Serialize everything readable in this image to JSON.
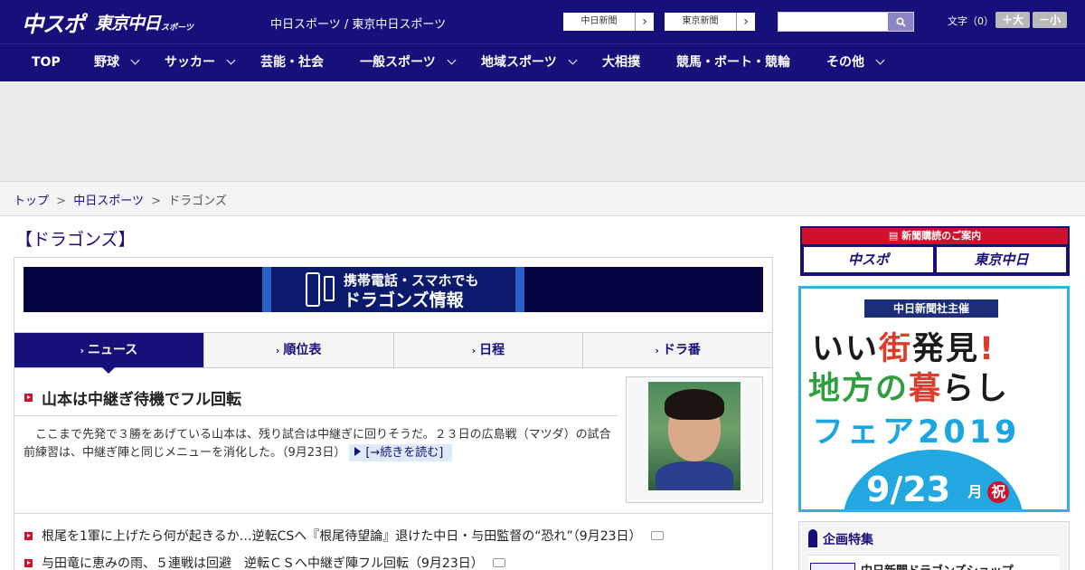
{
  "header": {
    "logo_main": "中スポ",
    "logo_sub": "東京中日",
    "logo_sub_small": "スポーツ",
    "site_name": "中日スポーツ / 東京中日スポーツ",
    "paper_links": [
      {
        "label": "中日新聞"
      },
      {
        "label": "東京新聞"
      }
    ],
    "search": {
      "placeholder": "",
      "value": ""
    },
    "font_size_label": "文字（0）",
    "font_larger": "＋大",
    "font_smaller": "－小"
  },
  "nav": {
    "items": [
      {
        "label": "TOP",
        "has_dropdown": false
      },
      {
        "label": "野球",
        "has_dropdown": true
      },
      {
        "label": "サッカー",
        "has_dropdown": true
      },
      {
        "label": "芸能・社会",
        "has_dropdown": false
      },
      {
        "label": "一般スポーツ",
        "has_dropdown": true
      },
      {
        "label": "地域スポーツ",
        "has_dropdown": true
      },
      {
        "label": "大相撲",
        "has_dropdown": false
      },
      {
        "label": "競馬・ボート・競輪",
        "has_dropdown": false
      },
      {
        "label": "その他",
        "has_dropdown": true
      }
    ]
  },
  "breadcrumb": {
    "items": [
      "トップ",
      "中日スポーツ",
      "ドラゴンズ"
    ],
    "separator": ">"
  },
  "main": {
    "heading": "【ドラゴンズ】",
    "banner": {
      "line1": "携帯電話・スマホでも",
      "line2": "ドラゴンズ情報"
    },
    "tabs": [
      {
        "label": "ニュース",
        "active": true
      },
      {
        "label": "順位表",
        "active": false
      },
      {
        "label": "日程",
        "active": false
      },
      {
        "label": "ドラ番",
        "active": false
      }
    ],
    "top_article": {
      "headline": "山本は中継ぎ待機でフル回転",
      "lead": "　ここまで先発で３勝をあげている山本は、残り試合は中継ぎに回りそうだ。２３日の広島戦（マツダ）の試合前練習は、中継ぎ陣と同じメニューを消化した。（9月23日）",
      "read_more": "[→続きを読む]"
    },
    "news_list": [
      {
        "title": "根尾を1軍に上げたら何が起きるか…逆転CSへ『根尾待望論』退けた中日・与田監督の“恐れ”（9月23日）",
        "has_photo": true
      },
      {
        "title": "与田竜に恵みの雨、５連戦は回避　逆転ＣＳへ中継ぎ陣フル回転（9月23日）",
        "has_photo": true
      }
    ]
  },
  "sidebar": {
    "subscription": {
      "heading": "新聞購読のご案内",
      "buttons": [
        "中スポ",
        "東京中日"
      ]
    },
    "fair_ad": {
      "sponsor": "中日新聞社主催",
      "line1_a": "いい",
      "line1_b": "街",
      "line1_c": "発見",
      "line1_d": "!",
      "line2_a": "地方の",
      "line2_b": "暮",
      "line2_c": "らし",
      "line3": "フェア2019",
      "date": "9/23",
      "weekday": "月",
      "holiday": "祝"
    },
    "feature": {
      "title": "企画特集",
      "item": "中日新聞ドラゴンズショップ"
    }
  },
  "colors": {
    "brand_navy": "#170f7a",
    "accent_red": "#d0112b",
    "fair_blue": "#22a7e0"
  }
}
